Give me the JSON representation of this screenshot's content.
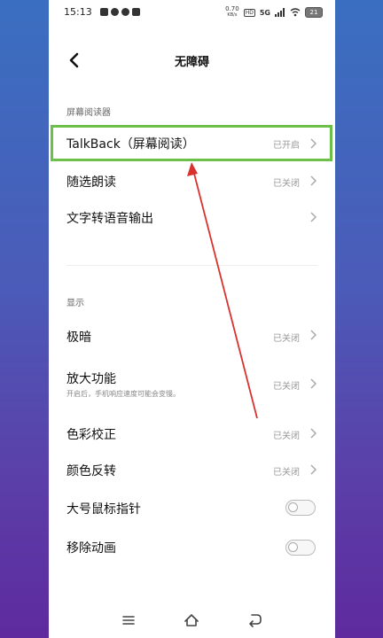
{
  "status": {
    "time": "15:13",
    "speed_top": "0.70",
    "speed_bottom": "KB/s",
    "network": "5G",
    "battery": "21"
  },
  "header": {
    "title": "无障碍"
  },
  "sections": {
    "screen_reader": "屏幕阅读器",
    "display": "显示"
  },
  "rows": {
    "talkback": {
      "title": "TalkBack（屏幕阅读）",
      "status": "已开启"
    },
    "select_to_speak": {
      "title": "随选朗读",
      "status": "已关闭"
    },
    "tts": {
      "title": "文字转语音输出"
    },
    "extra_dim": {
      "title": "极暗",
      "status": "已关闭"
    },
    "magnify": {
      "title": "放大功能",
      "subtitle": "开启后，手机响应速度可能会变慢。",
      "status": "已关闭"
    },
    "color_correction": {
      "title": "色彩校正",
      "status": "已关闭"
    },
    "color_inversion": {
      "title": "颜色反转",
      "status": "已关闭"
    },
    "large_pointer": {
      "title": "大号鼠标指针",
      "enabled": false
    },
    "remove_animations": {
      "title": "移除动画",
      "enabled": false
    }
  },
  "colors": {
    "highlight": "#6cc04a",
    "arrow": "#d9322e"
  }
}
